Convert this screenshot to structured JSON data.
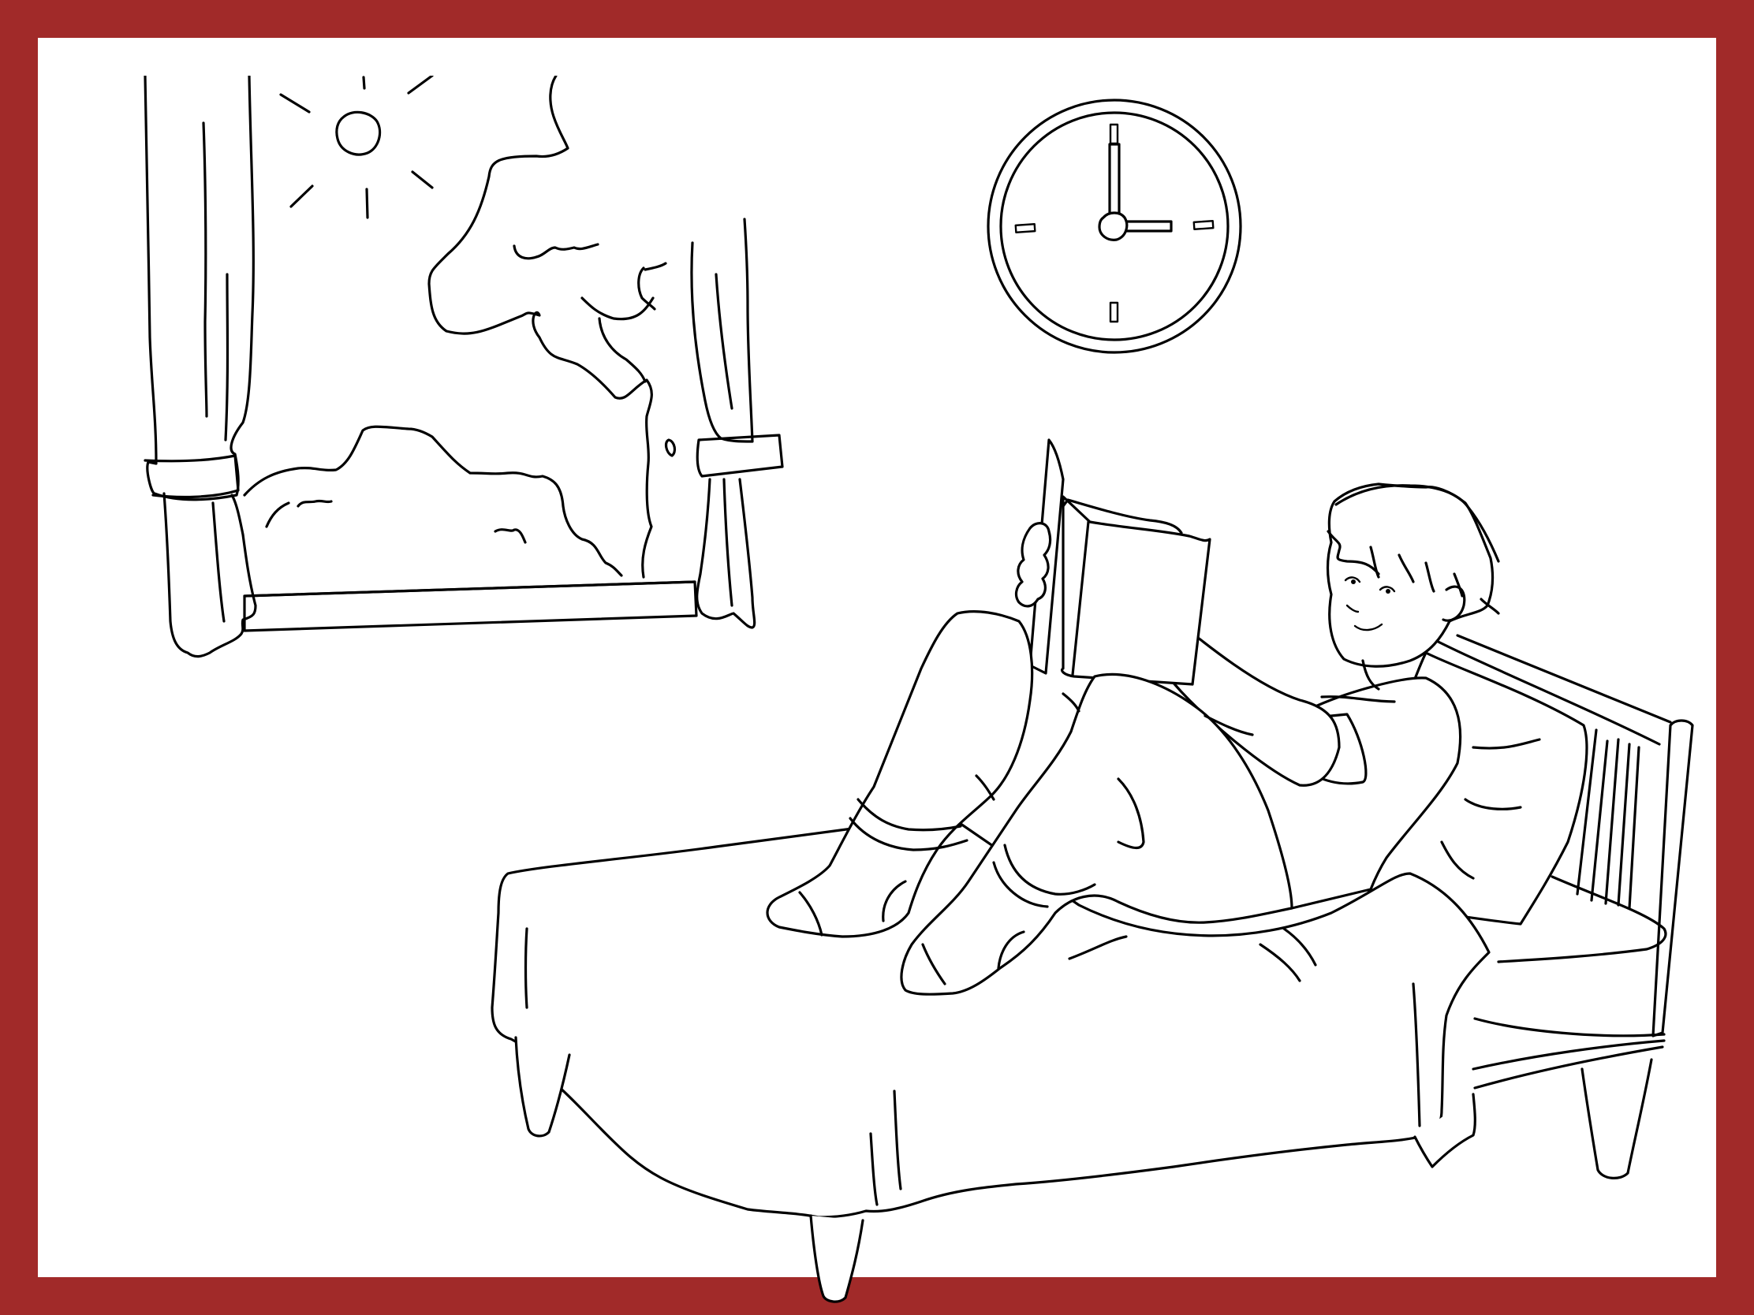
{
  "colors": {
    "border": "#a12a29",
    "background": "#ffffff",
    "line": "#000000"
  },
  "clock": {
    "hour": 3,
    "minute": 0
  },
  "icons": {
    "sun": "sun-icon",
    "clock": "wall-clock-icon",
    "book": "book-icon"
  }
}
